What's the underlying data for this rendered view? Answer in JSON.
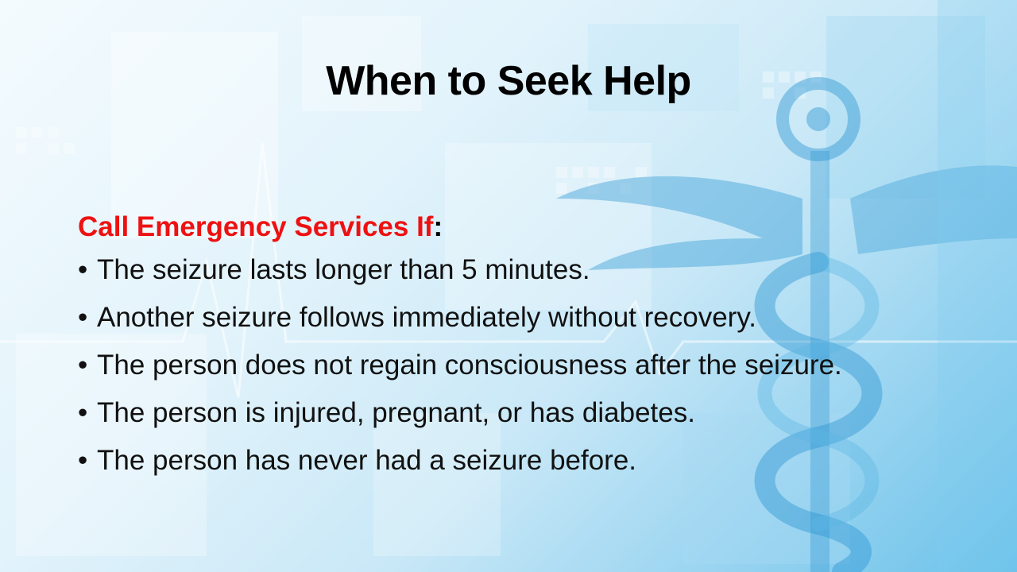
{
  "slide": {
    "title": "When to Seek Help",
    "heading": {
      "red_text": "Call Emergency Services If",
      "suffix": ":"
    },
    "bullet_glyph": "•",
    "bullets": [
      "The seizure lasts longer than 5 minutes.",
      "Another seizure follows immediately without recovery.",
      "The person does not regain consciousness after the seizure.",
      "The person is injured, pregnant, or has diabetes.",
      "The person has never had a seizure before."
    ]
  },
  "colors": {
    "heading_red": "#ee1111",
    "text": "#111111",
    "background_blue": "#6bc2ea"
  },
  "icons": {
    "background": "caduceus-medical-icon"
  }
}
